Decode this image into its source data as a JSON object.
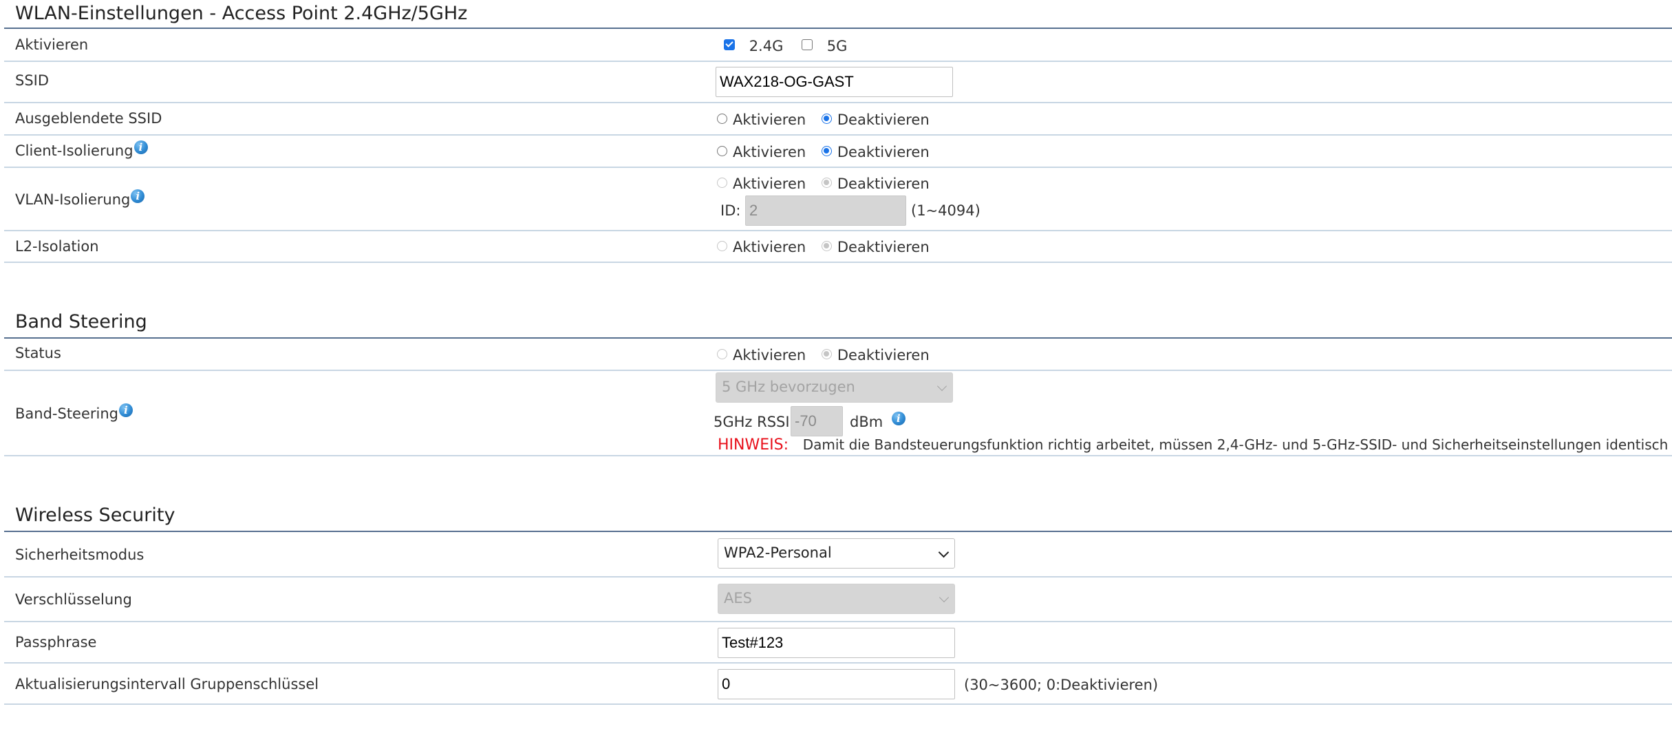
{
  "wlan": {
    "title": "WLAN-Einstellungen - Access Point 2.4GHz/5GHz",
    "aktivieren_label": "Aktivieren",
    "band24_label": "2.4G",
    "band24_checked": true,
    "band5_label": "5G",
    "band5_checked": false,
    "ssid_label": "SSID",
    "ssid_value": "WAX218-OG-GAST",
    "hidden_ssid_label": "Ausgeblendete SSID",
    "client_iso_label": "Client-Isolierung",
    "vlan_iso_label": "VLAN-Isolierung",
    "vlan_id_label": "ID:",
    "vlan_id_value": "2",
    "vlan_id_range": "(1~4094)",
    "l2_label": "L2-Isolation",
    "opt_enable": "Aktivieren",
    "opt_disable": "Deaktivieren"
  },
  "band_steering": {
    "title": "Band Steering",
    "status_label": "Status",
    "band_steering_label": "Band-Steering",
    "preference_value": "5 GHz bevorzugen",
    "rssi_label": "5GHz RSSI",
    "rssi_value": "-70",
    "rssi_unit": "dBm",
    "hinweis_label": "HINWEIS:",
    "hinweis_text": "Damit die Bandsteuerungsfunktion richtig arbeitet, müssen 2,4-GHz- und 5-GHz-SSID- und Sicherheitseinstellungen identisch sein."
  },
  "security": {
    "title": "Wireless Security",
    "mode_label": "Sicherheitsmodus",
    "mode_value": "WPA2-Personal",
    "encryption_label": "Verschlüsselung",
    "encryption_value": "AES",
    "passphrase_label": "Passphrase",
    "passphrase_value": "Test#123",
    "group_key_label": "Aktualisierungsintervall Gruppenschlüssel",
    "group_key_value": "0",
    "group_key_range": "(30~3600; 0:Deaktivieren)"
  },
  "icons": {
    "info": "info-icon",
    "dropdown": "chevron-down-icon"
  },
  "colors": {
    "accent": "#1a73e8",
    "title_rule": "#566f8f",
    "row_rule": "#c8d6e3",
    "hinweis": "#e8101b"
  }
}
